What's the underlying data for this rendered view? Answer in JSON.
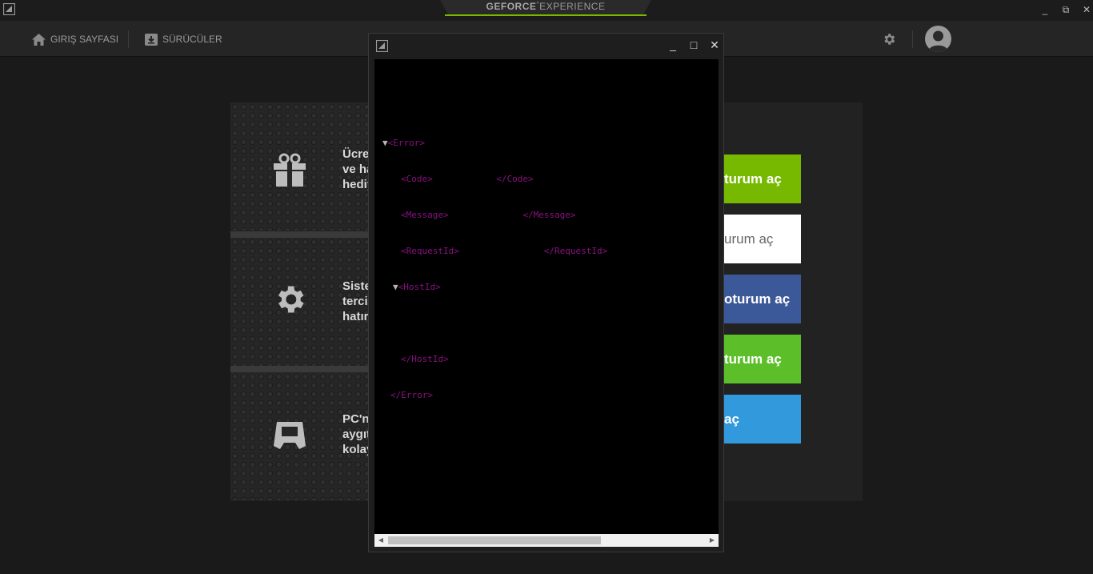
{
  "app": {
    "brand_bold": "GEFORCE",
    "brand_light": "EXPERIENCE",
    "window_buttons": [
      "_",
      "⧉",
      "✕"
    ]
  },
  "nav": {
    "items": [
      {
        "label": "GIRIŞ SAYFASI",
        "icon": "home-icon"
      },
      {
        "label": "SÜRÜCÜLER",
        "icon": "drivers-icon"
      }
    ],
    "settings_icon": "gear-icon",
    "avatar_icon": "avatar-icon"
  },
  "features": [
    {
      "icon": "gift-icon",
      "lines": [
        "Ücre",
        "ve ha",
        "hediy"
      ]
    },
    {
      "icon": "gear-icon",
      "lines": [
        "Siste",
        "terci",
        "hatır"
      ]
    },
    {
      "icon": "shield-device-icon",
      "lines": [
        "PC'n",
        "aygıt",
        "kolay"
      ]
    }
  ],
  "login_buttons": [
    {
      "label": "turum aç",
      "bg": "#76b900",
      "fg": "#ffffff"
    },
    {
      "label": "urum aç",
      "bg": "#ffffff",
      "fg": "#666666"
    },
    {
      "label": "oturum aç",
      "bg": "#3b5998",
      "fg": "#ffffff"
    },
    {
      "label": "turum aç",
      "bg": "#5cbf2a",
      "fg": "#ffffff"
    },
    {
      "label": "aç",
      "bg": "#3399dd",
      "fg": "#ffffff"
    }
  ],
  "popup": {
    "buttons": [
      "_",
      "□",
      "✕"
    ],
    "xml_lines": [
      {
        "tri": "▼",
        "text": "<Error>",
        "indent": 0
      },
      {
        "tri": "",
        "text": "<Code>            </Code>",
        "indent": 1
      },
      {
        "tri": "",
        "text": "<Message>              </Message>",
        "indent": 1
      },
      {
        "tri": "",
        "text": "<RequestId>                </RequestId>",
        "indent": 1
      },
      {
        "tri": "▼",
        "text": "<HostId>",
        "indent": 1
      },
      {
        "tri": "",
        "text": "",
        "indent": 2
      },
      {
        "tri": "",
        "text": "</HostId>",
        "indent": 1
      },
      {
        "tri": "",
        "text": "</Error>",
        "indent": 0
      }
    ]
  }
}
